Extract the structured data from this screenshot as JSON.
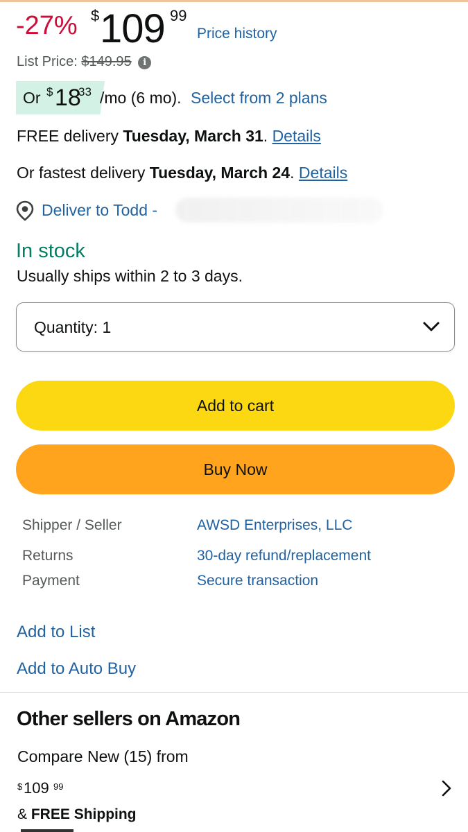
{
  "price": {
    "discount": "-27%",
    "currency": "$",
    "whole": "109",
    "fraction": "99",
    "history_link": "Price history"
  },
  "list_price": {
    "label": "List Price:",
    "value": "$149.95",
    "info_icon": "info-icon"
  },
  "installment": {
    "prefix": "Or",
    "currency": "$",
    "whole": "18",
    "fraction": "33",
    "term": "/mo (6 mo).",
    "link": "Select from 2 plans"
  },
  "delivery": {
    "free_prefix": "FREE delivery",
    "free_date": "Tuesday, March 31",
    "free_details": "Details",
    "fast_prefix": "Or fastest delivery",
    "fast_date": "Tuesday, March 24",
    "fast_details": "Details",
    "deliver_to": "Deliver to Todd -",
    "location_icon": "location-pin-icon"
  },
  "stock": {
    "status": "In stock",
    "ships": "Usually ships within 2 to 3 days."
  },
  "quantity": {
    "label": "Quantity:",
    "value": "1"
  },
  "buttons": {
    "add_to_cart": "Add to cart",
    "buy_now": "Buy Now"
  },
  "details": [
    {
      "label": "Shipper / Seller",
      "value": "AWSD Enterprises, LLC"
    },
    {
      "label": "Returns",
      "value": "30-day refund/replacement"
    },
    {
      "label": "Payment",
      "value": "Secure transaction"
    }
  ],
  "actions": {
    "add_to_list": "Add to List",
    "add_to_auto_buy": "Add to Auto Buy"
  },
  "other_sellers": {
    "title": "Other sellers on Amazon",
    "compare": "Compare New (15) from",
    "currency": "$",
    "whole": "109",
    "fraction": "99",
    "shipping_prefix": "&",
    "shipping": "FREE Shipping"
  },
  "colors": {
    "discount": "#cc0c39",
    "link": "#2162a1",
    "in_stock": "#067d62",
    "add_to_cart": "#fcd813",
    "buy_now": "#ffa41c",
    "installment_badge": "#d4f1e5"
  }
}
